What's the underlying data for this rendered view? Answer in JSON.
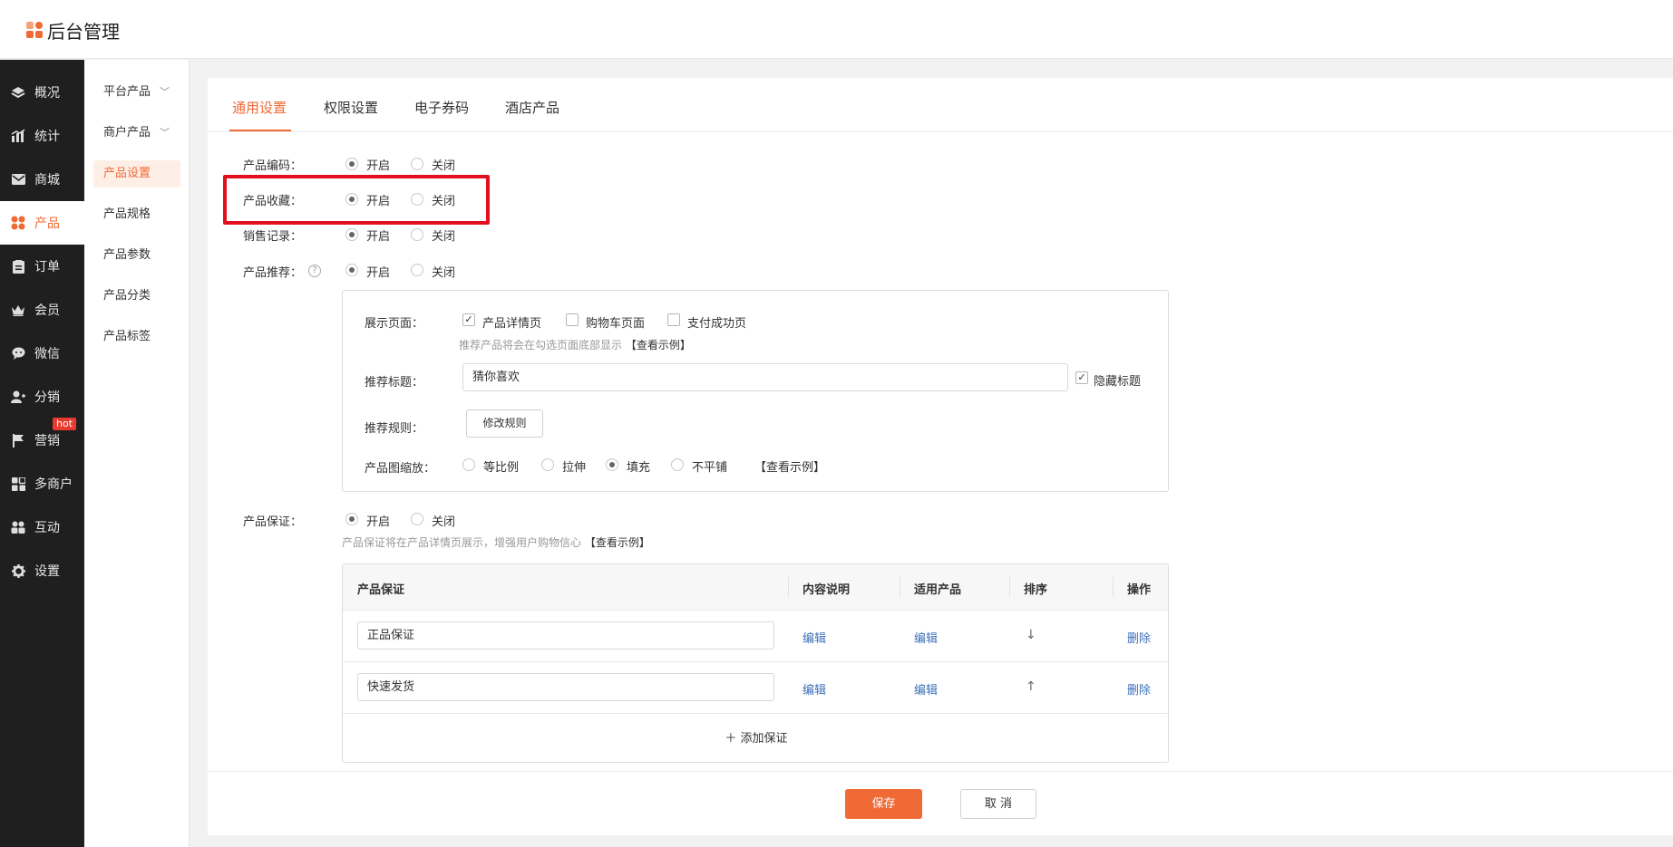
{
  "app": {
    "title": "后台管理"
  },
  "main_nav": [
    {
      "label": "概况",
      "icon": "layers-icon"
    },
    {
      "label": "统计",
      "icon": "chart-icon"
    },
    {
      "label": "商城",
      "icon": "mail-icon"
    },
    {
      "label": "产品",
      "icon": "grid-icon",
      "active": true
    },
    {
      "label": "订单",
      "icon": "clipboard-icon"
    },
    {
      "label": "会员",
      "icon": "crown-icon"
    },
    {
      "label": "微信",
      "icon": "chat-icon"
    },
    {
      "label": "分销",
      "icon": "users-icon"
    },
    {
      "label": "营销",
      "icon": "flag-icon",
      "badge": "hot"
    },
    {
      "label": "多商户",
      "icon": "store-icon"
    },
    {
      "label": "互动",
      "icon": "people-icon"
    },
    {
      "label": "设置",
      "icon": "gear-icon"
    }
  ],
  "sub_nav": [
    {
      "label": "平台产品",
      "expandable": true
    },
    {
      "label": "商户产品",
      "expandable": true
    },
    {
      "label": "产品设置",
      "active": true
    },
    {
      "label": "产品规格"
    },
    {
      "label": "产品参数"
    },
    {
      "label": "产品分类"
    },
    {
      "label": "产品标签"
    }
  ],
  "tabs": [
    "通用设置",
    "权限设置",
    "电子券码",
    "酒店产品"
  ],
  "settings": {
    "on_label": "开启",
    "off_label": "关闭",
    "code": {
      "label": "产品编码：",
      "value": "开启"
    },
    "favorite": {
      "label": "产品收藏：",
      "value": "开启"
    },
    "sales": {
      "label": "销售记录：",
      "value": "开启"
    },
    "recommend": {
      "label": "产品推荐：",
      "value": "开启"
    }
  },
  "recommend_panel": {
    "display_label": "展示页面：",
    "pages": [
      {
        "label": "产品详情页",
        "checked": true
      },
      {
        "label": "购物车页面",
        "checked": false
      },
      {
        "label": "支付成功页",
        "checked": false
      }
    ],
    "display_hint": "推荐产品将会在勾选页面底部显示",
    "example_link": "【查看示例】",
    "title_label": "推荐标题：",
    "title_value": "猜你喜欢",
    "hide_title_label": "隐藏标题",
    "hide_title_checked": true,
    "rule_label": "推荐规则：",
    "rule_button": "修改规则",
    "scale_label": "产品图缩放：",
    "scale_options": [
      "等比例",
      "拉伸",
      "填充",
      "不平铺"
    ],
    "scale_value": "填充"
  },
  "guarantee": {
    "label": "产品保证：",
    "value": "开启",
    "hint": "产品保证将在产品详情页展示，增强用户购物信心",
    "example_link": "【查看示例】",
    "columns": [
      "产品保证",
      "内容说明",
      "适用产品",
      "排序",
      "操作"
    ],
    "rows": [
      {
        "name": "正品保证",
        "content": "编辑",
        "products": "编辑",
        "sort": "↓",
        "action": "删除"
      },
      {
        "name": "快速发货",
        "content": "编辑",
        "products": "编辑",
        "sort": "↑",
        "action": "删除"
      }
    ],
    "add_label": "＋ 添加保证"
  },
  "footer": {
    "save": "保存",
    "cancel": "取 消"
  },
  "colors": {
    "accent": "#f06a35",
    "nav_bg": "#1f1f1f",
    "link": "#3c6fb8",
    "highlight_box": "#e2101e"
  }
}
